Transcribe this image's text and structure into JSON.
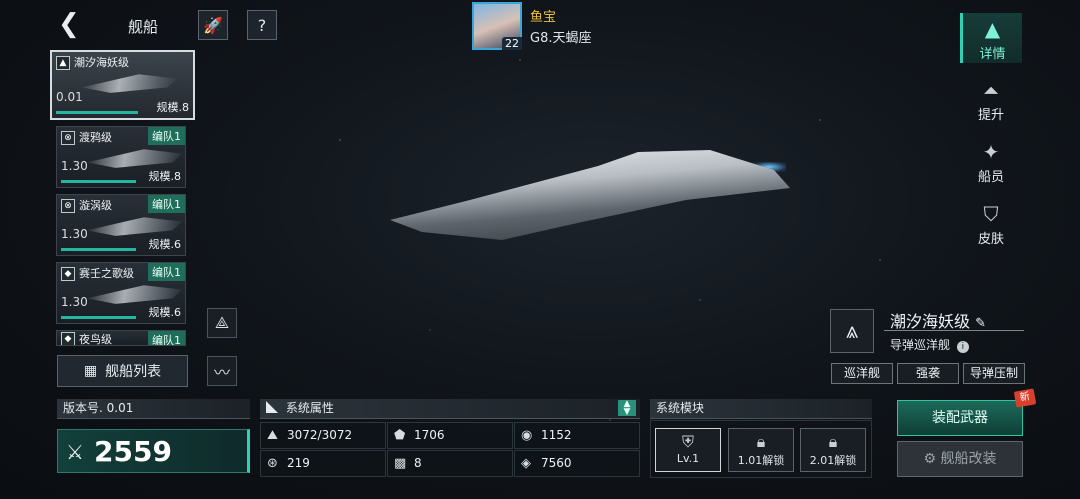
{
  "header": {
    "back_glyph": "❮",
    "title": "舰船",
    "rocket_icon": "rocket-icon",
    "help_icon": "help-icon"
  },
  "player": {
    "name": "鱼宝",
    "level": "22",
    "location": "G8.天蝎座"
  },
  "ship_list": [
    {
      "name": "潮汐海妖级",
      "version": "0.01",
      "scale": "规模.8",
      "fleet": "",
      "selected": true
    },
    {
      "name": "渡鸦级",
      "version": "1.30",
      "scale": "规模.8",
      "fleet": "编队1"
    },
    {
      "name": "漩涡级",
      "version": "1.30",
      "scale": "规模.6",
      "fleet": "编队1"
    },
    {
      "name": "赛壬之歌级",
      "version": "1.30",
      "scale": "规模.6",
      "fleet": "编队1"
    },
    {
      "name": "夜鸟级",
      "fleet": "编队1"
    }
  ],
  "ship_list_button": "舰船列表",
  "right_nav": [
    {
      "label": "详情",
      "active": true
    },
    {
      "label": "提升"
    },
    {
      "label": "船员"
    },
    {
      "label": "皮肤"
    }
  ],
  "ship_info": {
    "name": "潮汐海妖级",
    "class": "导弹巡洋舰",
    "tags": [
      "巡洋舰",
      "强袭",
      "导弹压制"
    ]
  },
  "version_panel": {
    "label": "版本号. 0.01",
    "power": "2559"
  },
  "attributes": {
    "title": "系统属性",
    "items": [
      "3072/3072",
      "1706",
      "1152",
      "219",
      "8",
      "7560"
    ]
  },
  "modules": {
    "title": "系统模块",
    "slots": [
      "Lv.1",
      "1.01解锁",
      "2.01解锁"
    ]
  },
  "actions": {
    "equip": "装配武器",
    "new_badge": "新",
    "refit": "舰船改装"
  },
  "colors": {
    "accent": "#2fd1b0",
    "fleet_badge": "#1f6d5a",
    "player_name": "#f0c23a",
    "new_badge": "#d8402b"
  }
}
